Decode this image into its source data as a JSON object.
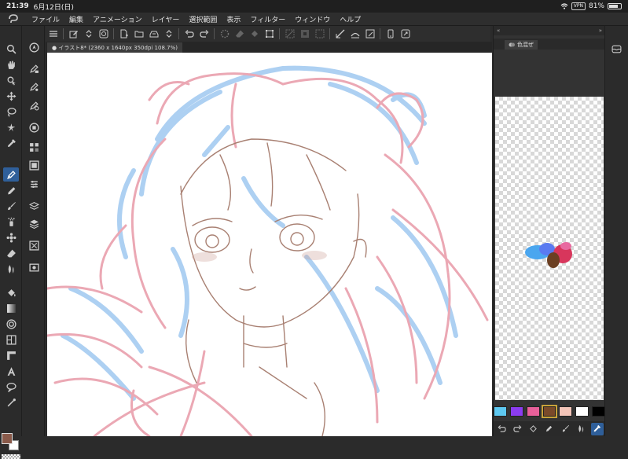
{
  "status": {
    "time": "21:39",
    "date": "6月12日(日)",
    "vpn": "VPN",
    "battery": "81%"
  },
  "menu": [
    "ファイル",
    "編集",
    "アニメーション",
    "レイヤー",
    "選択範囲",
    "表示",
    "フィルター",
    "ウィンドウ",
    "ヘルプ"
  ],
  "document_tab": "● イラスト8* (2360 x 1640px 350dpi 108.7%)",
  "right_panel": {
    "tab_label": "色混ぜ"
  },
  "palette": {
    "colors": [
      "#5ec8f0",
      "#8b3cf0",
      "#e8609a",
      "#7a4a2a",
      "#f2c4b8",
      "#ffffff",
      "#000000"
    ],
    "selected_index": 3
  },
  "current_colors": {
    "main": "#8a5a4a",
    "sub": "#ffffff"
  }
}
